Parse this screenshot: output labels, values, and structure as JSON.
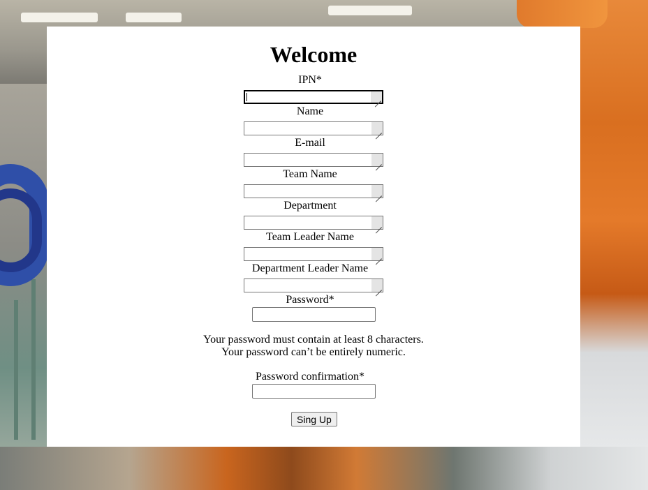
{
  "page": {
    "title": "Welcome"
  },
  "form": {
    "fields": [
      {
        "label": "IPN*",
        "value": ""
      },
      {
        "label": "Name",
        "value": ""
      },
      {
        "label": "E-mail",
        "value": ""
      },
      {
        "label": "Team Name",
        "value": ""
      },
      {
        "label": "Department",
        "value": ""
      },
      {
        "label": "Team Leader Name",
        "value": ""
      },
      {
        "label": "Department Leader Name",
        "value": ""
      }
    ],
    "password_label": "Password*",
    "password_help": [
      "Your password must contain at least 8 characters.",
      "Your password can’t be entirely numeric."
    ],
    "password_confirm_label": "Password confirmation*",
    "submit_label": "Sing Up"
  },
  "colors": {
    "panel_background": "#ffffff",
    "accent_background_right": "#e47a2a",
    "hose_blue": "#2f4fa8"
  }
}
